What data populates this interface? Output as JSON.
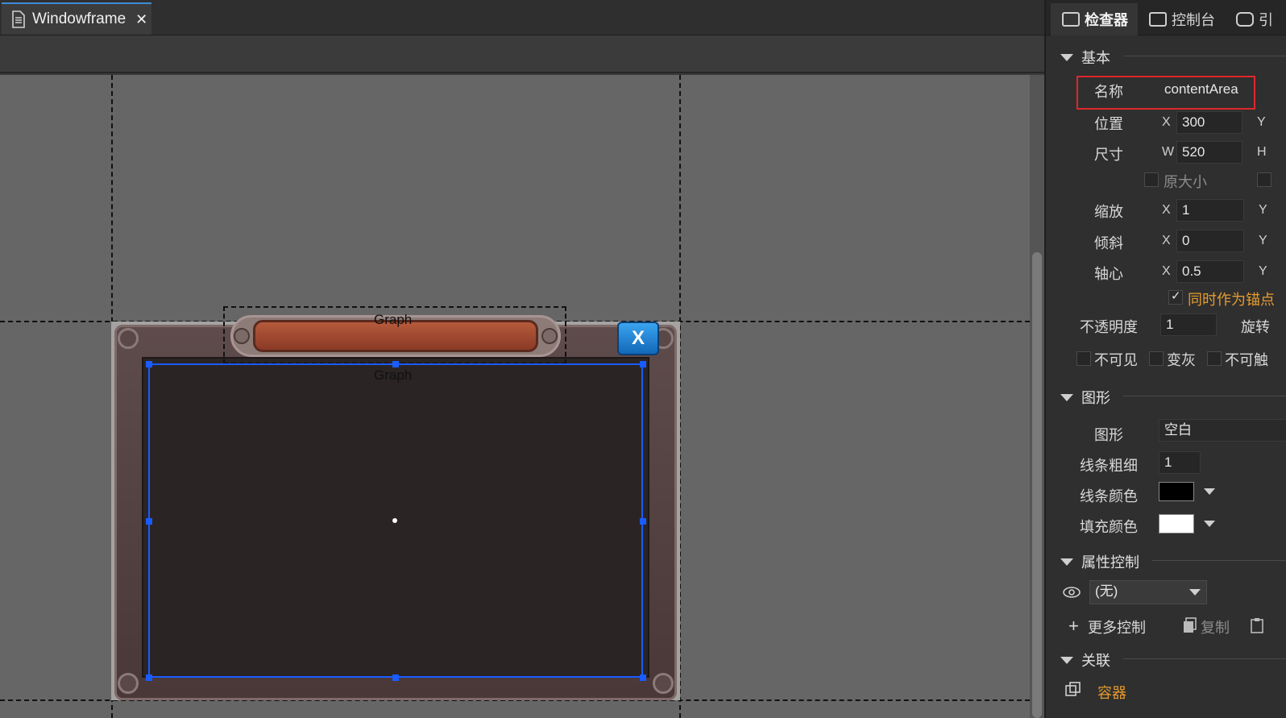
{
  "editor": {
    "tab_title": "Windowframe",
    "tab_close": "✕",
    "close_button_label": "X",
    "graph_labels": [
      "Graph",
      "Graph"
    ]
  },
  "inspector": {
    "tabs": [
      {
        "label": "检查器",
        "icon": "inspector-icon"
      },
      {
        "label": "控制台",
        "icon": "console-icon"
      },
      {
        "label": "引",
        "icon": "reference-icon"
      }
    ],
    "basic": {
      "section": "基本",
      "name_label": "名称",
      "name_value": "contentArea",
      "position_label": "位置",
      "position_x_axis": "X",
      "position_x": "300",
      "position_y_axis": "Y",
      "size_label": "尺寸",
      "size_w_axis": "W",
      "size_w": "520",
      "size_h_axis": "H",
      "original_size_label": "原大小",
      "scale_label": "缩放",
      "scale_x_axis": "X",
      "scale_x": "1",
      "scale_y_axis": "Y",
      "skew_label": "倾斜",
      "skew_x_axis": "X",
      "skew_x": "0",
      "skew_y_axis": "Y",
      "pivot_label": "轴心",
      "pivot_x_axis": "X",
      "pivot_x": "0.5",
      "pivot_y_axis": "Y",
      "anchor_label": "同时作为锚点",
      "opacity_label": "不透明度",
      "opacity_value": "1",
      "rotation_label": "旋转",
      "invisible_label": "不可见",
      "gray_label": "变灰",
      "untouchable_label": "不可触"
    },
    "graph": {
      "section": "图形",
      "shape_label": "图形",
      "shape_value": "空白",
      "line_width_label": "线条粗细",
      "line_width_value": "1",
      "line_color_label": "线条颜色",
      "line_color": "#000000",
      "fill_color_label": "填充颜色",
      "fill_color": "#ffffff"
    },
    "prop_control": {
      "section": "属性控制",
      "dropdown_value": "(无)",
      "more_control": "更多控制",
      "copy": "复制"
    },
    "relation": {
      "section": "关联",
      "container": "容器"
    }
  }
}
